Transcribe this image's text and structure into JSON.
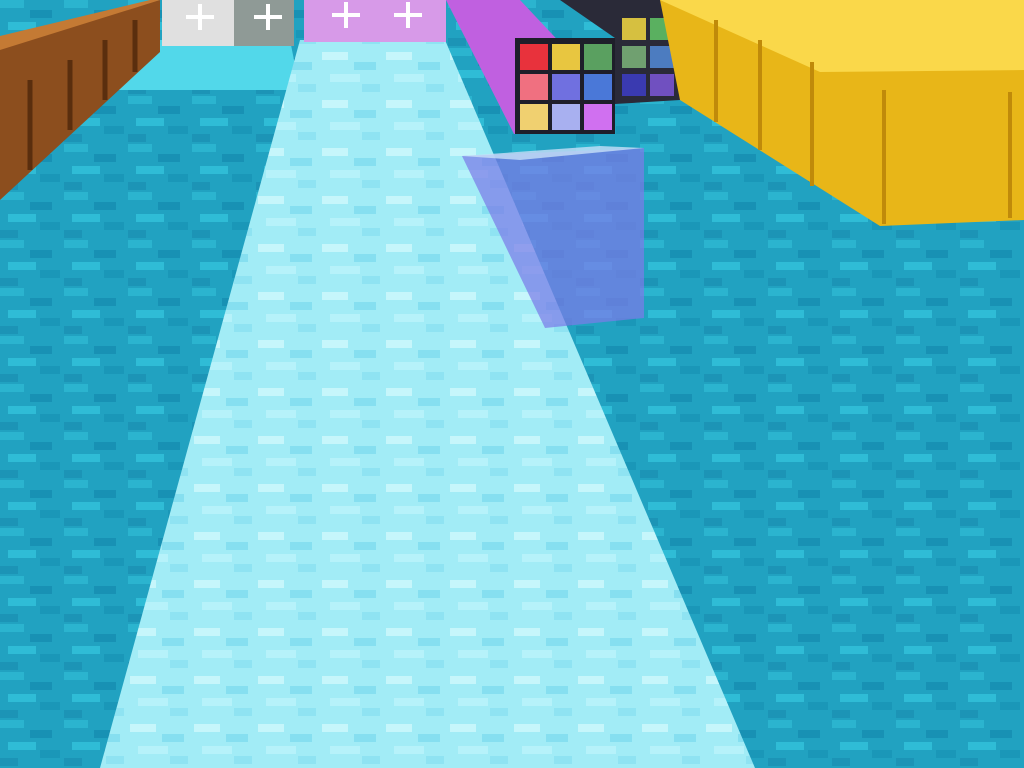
{
  "scene": {
    "kind": "first-person voxel world view",
    "hud_visible": false,
    "blocks": [
      {
        "name": "prismarine-floor",
        "color": "#22a6c4"
      },
      {
        "name": "packed-ice-path",
        "color": "#9eeaf4"
      },
      {
        "name": "wooden-barrel-row",
        "color": "#9c5a26"
      },
      {
        "name": "rainbow-stained-glass-row",
        "color": "#c060e0"
      },
      {
        "name": "dark-glass-lantern-row",
        "color": "#3a3a48"
      },
      {
        "name": "gold-block-row",
        "color": "#f2c21e"
      },
      {
        "name": "purple-glass-pane",
        "color": "#7c7ce8"
      },
      {
        "name": "quartz-pillar-white",
        "color": "#e6e6e6"
      },
      {
        "name": "magenta-glazed-block",
        "color": "#d79ae8"
      },
      {
        "name": "lapis-strip",
        "color": "#3a66e6"
      }
    ]
  }
}
